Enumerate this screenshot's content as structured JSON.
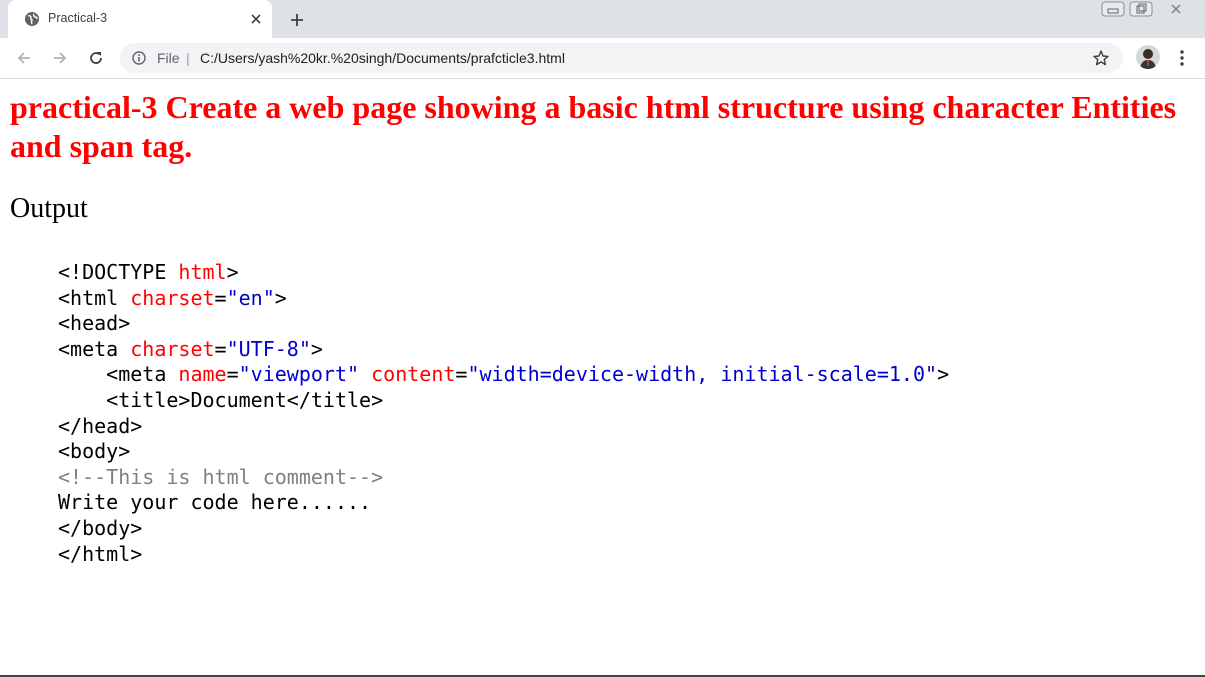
{
  "browser": {
    "tab_title": "Practical-3",
    "omnibox": {
      "scheme_label": "File",
      "separator": "|",
      "url": "C:/Users/yash%20kr.%20singh/Documents/prafcticle3.html"
    },
    "icons": [
      "globe-icon",
      "close-icon",
      "plus-icon",
      "back-arrow-icon",
      "forward-arrow-icon",
      "reload-icon",
      "info-icon",
      "star-icon",
      "avatar",
      "more-vert-icon",
      "minimize-icon",
      "restore-icon",
      "window-close-icon"
    ]
  },
  "page": {
    "heading": "practical-3 Create a web page showing a basic html structure using character Entities and span tag.",
    "output_label": "Output",
    "code_lines": [
      [
        {
          "t": "<!DOCTYPE ",
          "c": "plain"
        },
        {
          "t": "html",
          "c": "attr"
        },
        {
          "t": ">",
          "c": "plain"
        }
      ],
      [
        {
          "t": "<html ",
          "c": "plain"
        },
        {
          "t": "charset",
          "c": "attr"
        },
        {
          "t": "=",
          "c": "plain"
        },
        {
          "t": "\"en\"",
          "c": "str"
        },
        {
          "t": ">",
          "c": "plain"
        }
      ],
      [
        {
          "t": "<head>",
          "c": "plain"
        }
      ],
      [
        {
          "t": "<meta ",
          "c": "plain"
        },
        {
          "t": "charset",
          "c": "attr"
        },
        {
          "t": "=",
          "c": "plain"
        },
        {
          "t": "\"UTF-8\"",
          "c": "str"
        },
        {
          "t": ">",
          "c": "plain"
        }
      ],
      [
        {
          "t": "    <meta ",
          "c": "plain"
        },
        {
          "t": "name",
          "c": "attr"
        },
        {
          "t": "=",
          "c": "plain"
        },
        {
          "t": "\"viewport\"",
          "c": "str"
        },
        {
          "t": " ",
          "c": "plain"
        },
        {
          "t": "content",
          "c": "attr"
        },
        {
          "t": "=",
          "c": "plain"
        },
        {
          "t": "\"width=device-width, initial-scale=1.0\"",
          "c": "str"
        },
        {
          "t": ">",
          "c": "plain"
        }
      ],
      [
        {
          "t": "    <title>Document</title>",
          "c": "plain"
        }
      ],
      [
        {
          "t": "</head>",
          "c": "plain"
        }
      ],
      [
        {
          "t": "<body>",
          "c": "plain"
        }
      ],
      [
        {
          "t": "<!--This is html comment-->",
          "c": "comment"
        }
      ],
      [
        {
          "t": "Write your code here......",
          "c": "plain"
        }
      ],
      [
        {
          "t": "</body>",
          "c": "plain"
        }
      ],
      [
        {
          "t": "</html>",
          "c": "plain"
        }
      ]
    ]
  },
  "colors": {
    "heading": "#ff0000",
    "attr": "#ff0000",
    "string": "#0000cd",
    "comment": "#808080",
    "tabstrip": "#dee1e6",
    "omnibox": "#f1f3f4"
  }
}
